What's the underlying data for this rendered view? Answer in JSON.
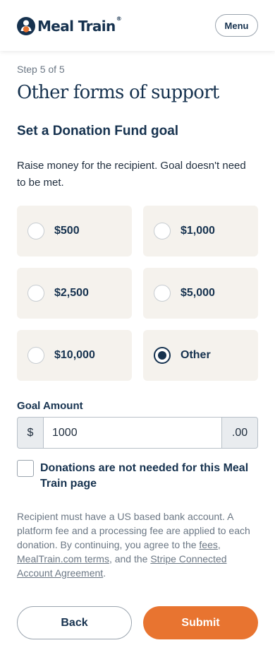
{
  "header": {
    "brand": "Meal Train",
    "brand_mark": "®",
    "menu_label": "Menu",
    "colors": {
      "brand": "#16324f",
      "accent": "#e87430"
    }
  },
  "step": "Step 5 of 5",
  "title": "Other forms of support",
  "section_title": "Set a Donation Fund goal",
  "description": "Raise money for the recipient. Goal doesn't need to be met.",
  "options": [
    {
      "label": "$500",
      "selected": false
    },
    {
      "label": "$1,000",
      "selected": false
    },
    {
      "label": "$2,500",
      "selected": false
    },
    {
      "label": "$5,000",
      "selected": false
    },
    {
      "label": "$10,000",
      "selected": false
    },
    {
      "label": "Other",
      "selected": true
    }
  ],
  "goal": {
    "label": "Goal Amount",
    "prefix": "$",
    "value": "1000",
    "suffix": ".00"
  },
  "opt_out": {
    "label": "Donations are not needed for this Meal Train page",
    "checked": false
  },
  "note": {
    "text_1": "Recipient must have a US based bank account. A platform fee and a processing fee are applied to each donation. By continuing, you agree to the ",
    "link_fees": "fees",
    "sep_1": ", ",
    "link_terms": "MealTrain.com terms",
    "sep_2": ", and the ",
    "link_stripe": "Stripe Connected Account Agreement",
    "end": "."
  },
  "buttons": {
    "back": "Back",
    "submit": "Submit"
  }
}
